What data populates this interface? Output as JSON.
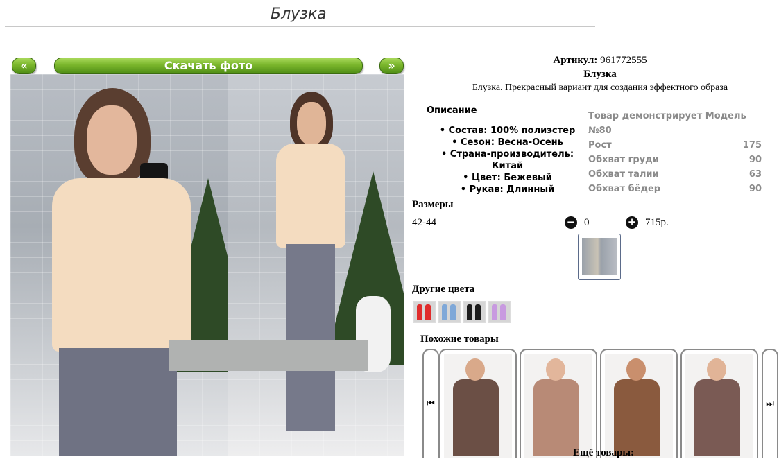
{
  "page": {
    "title": "Блузка"
  },
  "gallery": {
    "prev_label": "«",
    "download_label": "Скачать фото",
    "next_label": "»"
  },
  "product": {
    "sku_label": "Артикул:",
    "sku": "961772555",
    "name": "Блузка",
    "description": "Блузка. Прекрасный вариант для создания эффектного образа"
  },
  "details": {
    "heading": "Описание",
    "items": [
      "Состав: 100% полиэстер",
      "Сезон: Весна-Осень",
      "Страна-производитель: Китай",
      "Цвет: Бежевый",
      "Рукав: Длинный"
    ]
  },
  "model": {
    "title": "Товар демонстрирует Модель №80",
    "rows": [
      {
        "label": "Рост",
        "value": "175"
      },
      {
        "label": "Обхват груди",
        "value": "90"
      },
      {
        "label": "Обхват талии",
        "value": "63"
      },
      {
        "label": "Обхват бёдер",
        "value": "90"
      }
    ]
  },
  "sizes": {
    "label": "Размеры",
    "range": "42-44",
    "minus_icon": "minus-circle-icon",
    "plus_icon": "plus-circle-icon",
    "minus": "−",
    "plus": "+",
    "quantity": "0",
    "price": "715р."
  },
  "other_colors": {
    "label": "Другие цвета",
    "swatches": [
      "#e02c2c",
      "#7fa8d8",
      "#1c1c1c",
      "#c89ae0"
    ]
  },
  "similar": {
    "label": "Похожие товары",
    "prev_icon": "skip-back-icon",
    "next_icon": "skip-forward-icon",
    "prev": "⏮",
    "next": "⏭",
    "cards": [
      {
        "top_color": "#6b4f45",
        "skin": "#d9a98a"
      },
      {
        "top_color": "#b88a76",
        "skin": "#e2b69b"
      },
      {
        "top_color": "#8a5a3e",
        "skin": "#c98f6d"
      },
      {
        "top_color": "#7a5a54",
        "skin": "#e1b497"
      }
    ]
  },
  "more": {
    "label": "Ещё товары:"
  }
}
